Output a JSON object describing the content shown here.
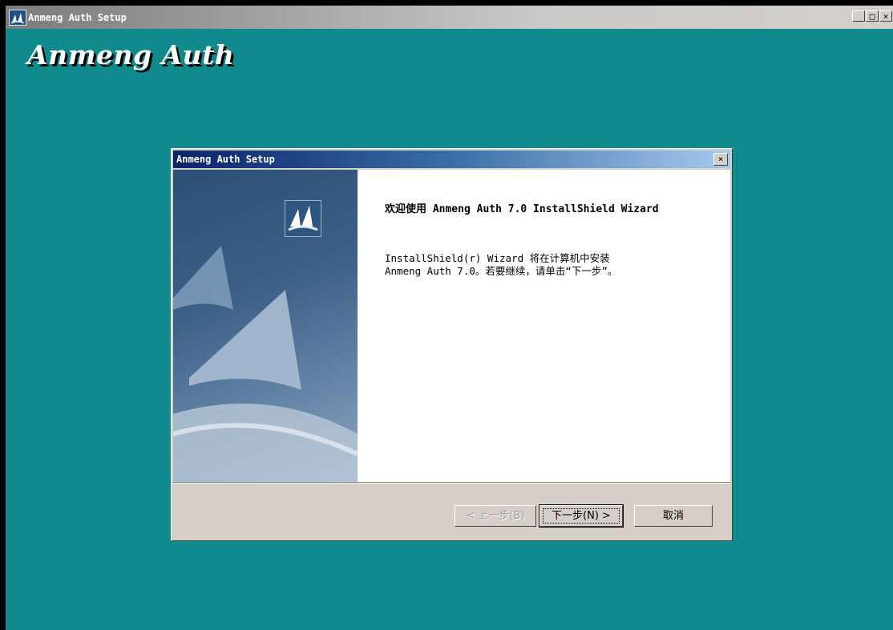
{
  "app": {
    "window_title": "Anmeng Auth Setup",
    "splash_title": "Anmeng Auth",
    "controls": {
      "minimize": "_",
      "maximize": "□",
      "close": "×"
    }
  },
  "dialog": {
    "title": "Anmeng Auth Setup",
    "close": "×",
    "welcome_heading": "欢迎使用 Anmeng Auth 7.0 InstallShield Wizard",
    "body_lines": [
      "InstallShield(r) Wizard 将在计算机中安装",
      "Anmeng Auth 7.0。若要继续，请单击“下一步”。"
    ],
    "buttons": {
      "back": "< 上一步(B)",
      "next": "下一步(N) >",
      "cancel": "取消"
    }
  },
  "colors": {
    "desktop": "#108a8c",
    "dialog_title_start": "#0a246a",
    "dialog_title_end": "#a6caf0",
    "button_face": "#d4d0c8"
  },
  "icons": [
    "installshield-app-icon",
    "minimize-icon",
    "maximize-icon",
    "close-icon",
    "wizard-logo-icon"
  ]
}
